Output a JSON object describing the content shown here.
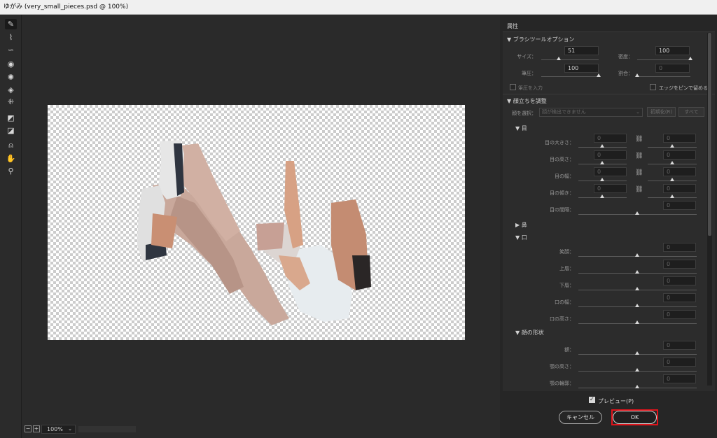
{
  "window": {
    "title": "ゆがみ (very_small_pieces.psd @ 100%)"
  },
  "toolbar": {
    "tools": [
      {
        "name": "forward-warp-tool-icon",
        "glyph": "✎",
        "active": true
      },
      {
        "name": "reconstruct-tool-icon",
        "glyph": "⌇"
      },
      {
        "name": "smooth-tool-icon",
        "glyph": "∽"
      },
      {
        "name": "twirl-tool-icon",
        "glyph": "◉"
      },
      {
        "name": "pucker-tool-icon",
        "glyph": "✺"
      },
      {
        "name": "bloat-tool-icon",
        "glyph": "◈"
      },
      {
        "name": "push-left-tool-icon",
        "glyph": "⁜"
      },
      {
        "name": "freeze-mask-tool-icon",
        "glyph": "◩"
      },
      {
        "name": "thaw-mask-tool-icon",
        "glyph": "◪"
      },
      {
        "name": "face-tool-icon",
        "glyph": "⍝"
      },
      {
        "name": "hand-tool-icon",
        "glyph": "✋"
      },
      {
        "name": "zoom-tool-icon",
        "glyph": "⚲"
      }
    ]
  },
  "canvas": {
    "zoom_out": "−",
    "zoom_in": "+",
    "zoom_level": "100%",
    "zoom_chevron": "⌄"
  },
  "panel": {
    "title": "属性",
    "brush": {
      "header": "▼ ブラシツールオプション",
      "size_label": "サイズ：",
      "size_value": "51",
      "size_level": 0.3,
      "density_label": "密度：",
      "density_value": "100",
      "density_level": 1.0,
      "pressure_label": "筆圧：",
      "pressure_value": "100",
      "pressure_level": 1.0,
      "rate_label": "割合：",
      "rate_value": "0",
      "rate_level": 0.0,
      "stylus_label": "筆圧を入力",
      "pin_edges_label": "エッジをピンで留める"
    },
    "face": {
      "header": "▼ 顔立ちを調整",
      "select_label": "顔を選択：",
      "select_value": "顔が検出できません",
      "reset_label": "初期化(R)",
      "all_label": "すべて",
      "eyes": {
        "header": "▼ 目",
        "rows": [
          {
            "label": "目の大きさ：",
            "left": "0",
            "right": "0",
            "link": true
          },
          {
            "label": "目の高さ：",
            "left": "0",
            "right": "0",
            "link": true
          },
          {
            "label": "目の幅：",
            "left": "0",
            "right": "0",
            "link": true
          },
          {
            "label": "目の傾き：",
            "left": "0",
            "right": "0",
            "link": true
          },
          {
            "label": "目の間隔：",
            "value": "0"
          }
        ]
      },
      "nose": {
        "header": "▶ 鼻"
      },
      "mouth": {
        "header": "▼ 口",
        "rows": [
          {
            "label": "笑顔：",
            "value": "0"
          },
          {
            "label": "上唇：",
            "value": "0"
          },
          {
            "label": "下唇：",
            "value": "0"
          },
          {
            "label": "口の幅：",
            "value": "0"
          },
          {
            "label": "口の高さ：",
            "value": "0"
          }
        ]
      },
      "shape": {
        "header": "▼ 顔の形状",
        "rows": [
          {
            "label": "額：",
            "value": "0"
          },
          {
            "label": "顎の高さ：",
            "value": "0"
          },
          {
            "label": "顎の輪郭：",
            "value": "0"
          }
        ]
      },
      "link_glyph": "⛓"
    }
  },
  "footer": {
    "preview_label": "プレビュー(P)",
    "preview_checked": true,
    "cancel_label": "キャンセル",
    "ok_label": "OK"
  },
  "colors": {
    "panel_bg": "#2c2c2c",
    "canvas_bg": "#2a2a2a",
    "highlight": "#e0141b"
  }
}
